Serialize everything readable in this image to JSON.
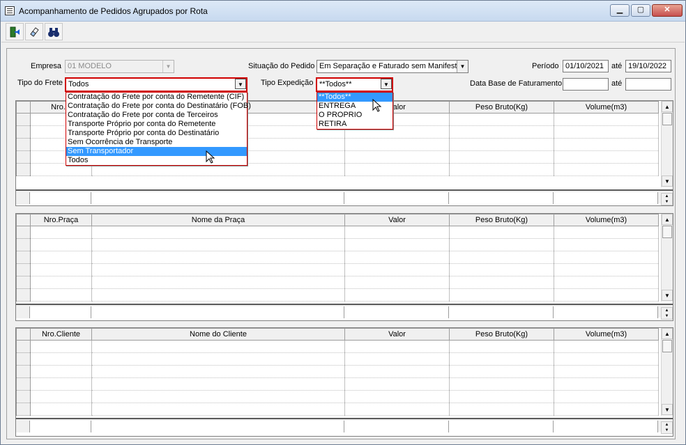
{
  "window": {
    "title": "Acompanhamento de Pedidos Agrupados por Rota",
    "buttons": [
      "▁",
      "▢",
      "✕"
    ]
  },
  "toolbar": {
    "buttons": [
      {
        "name": "exit-button",
        "icon": "exit-door-icon",
        "glyph": "🚪"
      },
      {
        "name": "clear-button",
        "icon": "eraser-icon",
        "glyph": "✎"
      },
      {
        "name": "search-button",
        "icon": "binoculars-icon",
        "glyph": "🔭"
      }
    ]
  },
  "form": {
    "empresa_label": "Empresa",
    "empresa_value": "01 MODELO",
    "situacao_label": "Situação do Pedido",
    "situacao_value": "Em Separação e Faturado sem Manifesto",
    "periodo_label": "Período",
    "periodo_de": "01/10/2021",
    "ate_label": "até",
    "periodo_ate": "19/10/2022",
    "tipo_frete_label": "Tipo do Frete",
    "tipo_frete_value": "Todos",
    "tipo_expedicao_label": "Tipo Expedição",
    "tipo_expedicao_value": "**Todos**",
    "data_base_label": "Data Base de Faturamento",
    "data_base_de": "",
    "ate2_label": "até",
    "data_base_ate": ""
  },
  "frete_dropdown": {
    "options": [
      "Contratação do Frete por conta do Remetente (CIF)",
      "Contratação do Frete por conta do Destinatário (FOB)",
      "Contratação do Frete por conta de Terceiros",
      "Transporte Próprio por conta do Remetente",
      "Transporte Próprio por conta do Destinatário",
      "Sem Ocorrência de Transporte",
      "Sem Transportador",
      "Todos"
    ],
    "highlighted": "Sem Transportador"
  },
  "expedicao_dropdown": {
    "options": [
      "**Todos**",
      "ENTREGA",
      "O PROPRIO",
      "RETIRA"
    ],
    "highlighted": "**Todos**"
  },
  "grid1": {
    "headers": [
      "Nro.R",
      "",
      "Valor",
      "Peso Bruto(Kg)",
      "Volume(m3)"
    ]
  },
  "grid2": {
    "headers": [
      "Nro.Praça",
      "Nome da Praça",
      "Valor",
      "Peso Bruto(Kg)",
      "Volume(m3)"
    ]
  },
  "grid3": {
    "headers": [
      "Nro.Cliente",
      "Nome do Cliente",
      "Valor",
      "Peso Bruto(Kg)",
      "Volume(m3)"
    ]
  },
  "colors": {
    "focus_border": "#d00000",
    "selection": "#3399ff"
  }
}
